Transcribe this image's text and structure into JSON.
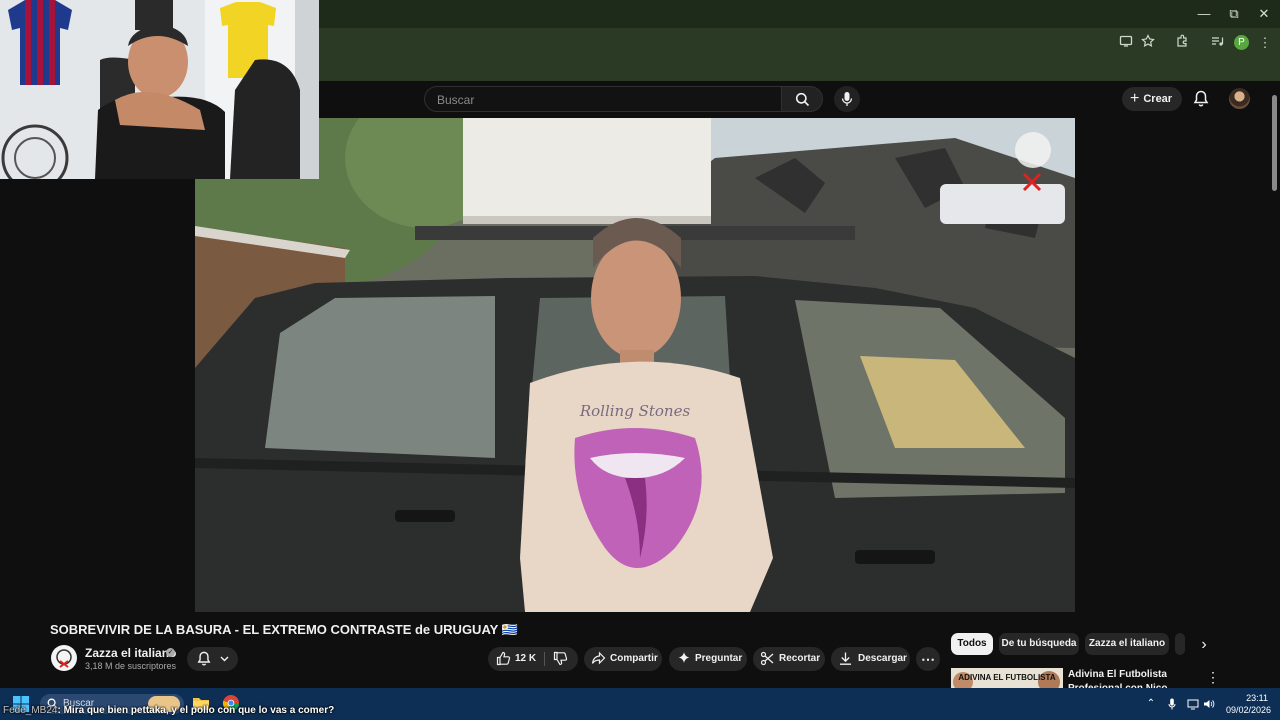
{
  "browser": {
    "window_controls": {
      "minimize": "—",
      "maximize": "⧉",
      "close": "✕"
    },
    "profile_initial": "P"
  },
  "masthead": {
    "search_placeholder": "Buscar",
    "create_label": "Crear"
  },
  "video": {
    "title": "SOBREVIVIR DE LA BASURA - EL EXTREMO CONTRASTE de URUGUAY 🇺🇾",
    "channel": {
      "name": "Zazza el italiano",
      "subscribers": "3,18 M de suscriptores"
    },
    "actions": {
      "like_count": "12 K",
      "share": "Compartir",
      "ask": "Preguntar",
      "clip": "Recortar",
      "download": "Descargar"
    },
    "scene_text": {
      "shirt_brand": "Rolling Stones"
    }
  },
  "sidebar": {
    "chips": [
      {
        "label": "Todos",
        "active": true
      },
      {
        "label": "De tu búsqueda",
        "active": false
      },
      {
        "label": "Zazza el italiano",
        "active": false
      }
    ],
    "recommendation": {
      "thumbnail_text": "ADIVINA EL FUTBOLISTA",
      "title": "Adivina El Futbolista Profesional con Nico Williams"
    }
  },
  "taskbar": {
    "search_label": "Buscar",
    "time": "23:11",
    "date": "09/02/2026"
  },
  "chat": {
    "user": "Fede_MB24",
    "message": ": Mira que bien pettaka, y el pollo con que lo vas a comer?"
  },
  "colors": {
    "youtube_bg": "#0f0f0f",
    "chrome_frame": "#2b3a24",
    "taskbar": "#0d2f55",
    "chip_active": "#f1f1f1"
  }
}
